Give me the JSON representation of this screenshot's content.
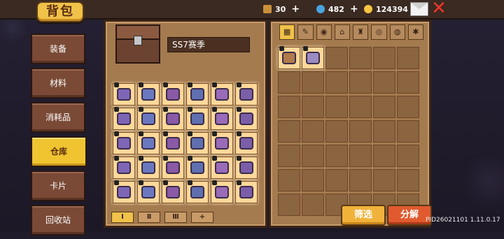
{
  "header": {
    "title": "背包",
    "resources": [
      {
        "name": "wood",
        "icon": "wood-icon",
        "value": "30",
        "color": "#c98f3a"
      },
      {
        "name": "gem",
        "icon": "gem-icon",
        "value": "482",
        "color": "#4aa3e0"
      },
      {
        "name": "coin",
        "icon": "coin-icon",
        "value": "124394",
        "color": "#f5c542"
      }
    ],
    "plus": "+"
  },
  "sidebar": {
    "items": [
      {
        "label": "装备",
        "active": false
      },
      {
        "label": "材料",
        "active": false
      },
      {
        "label": "消耗品",
        "active": false
      },
      {
        "label": "仓库",
        "active": true
      },
      {
        "label": "卡片",
        "active": false
      },
      {
        "label": "回收站",
        "active": false
      }
    ]
  },
  "warehouse": {
    "season_name": "SS7赛季",
    "page_tabs": [
      "Ⅰ",
      "Ⅱ",
      "Ⅲ",
      "+"
    ]
  },
  "inventory": {
    "categories": [
      "▦",
      "✎",
      "◉",
      "⌂",
      "♜",
      "◎",
      "◍",
      "✱"
    ]
  },
  "buttons": {
    "filter": "筛选",
    "decompose": "分解"
  },
  "footer": {
    "version": "PID26021101 1.11.0.17"
  }
}
